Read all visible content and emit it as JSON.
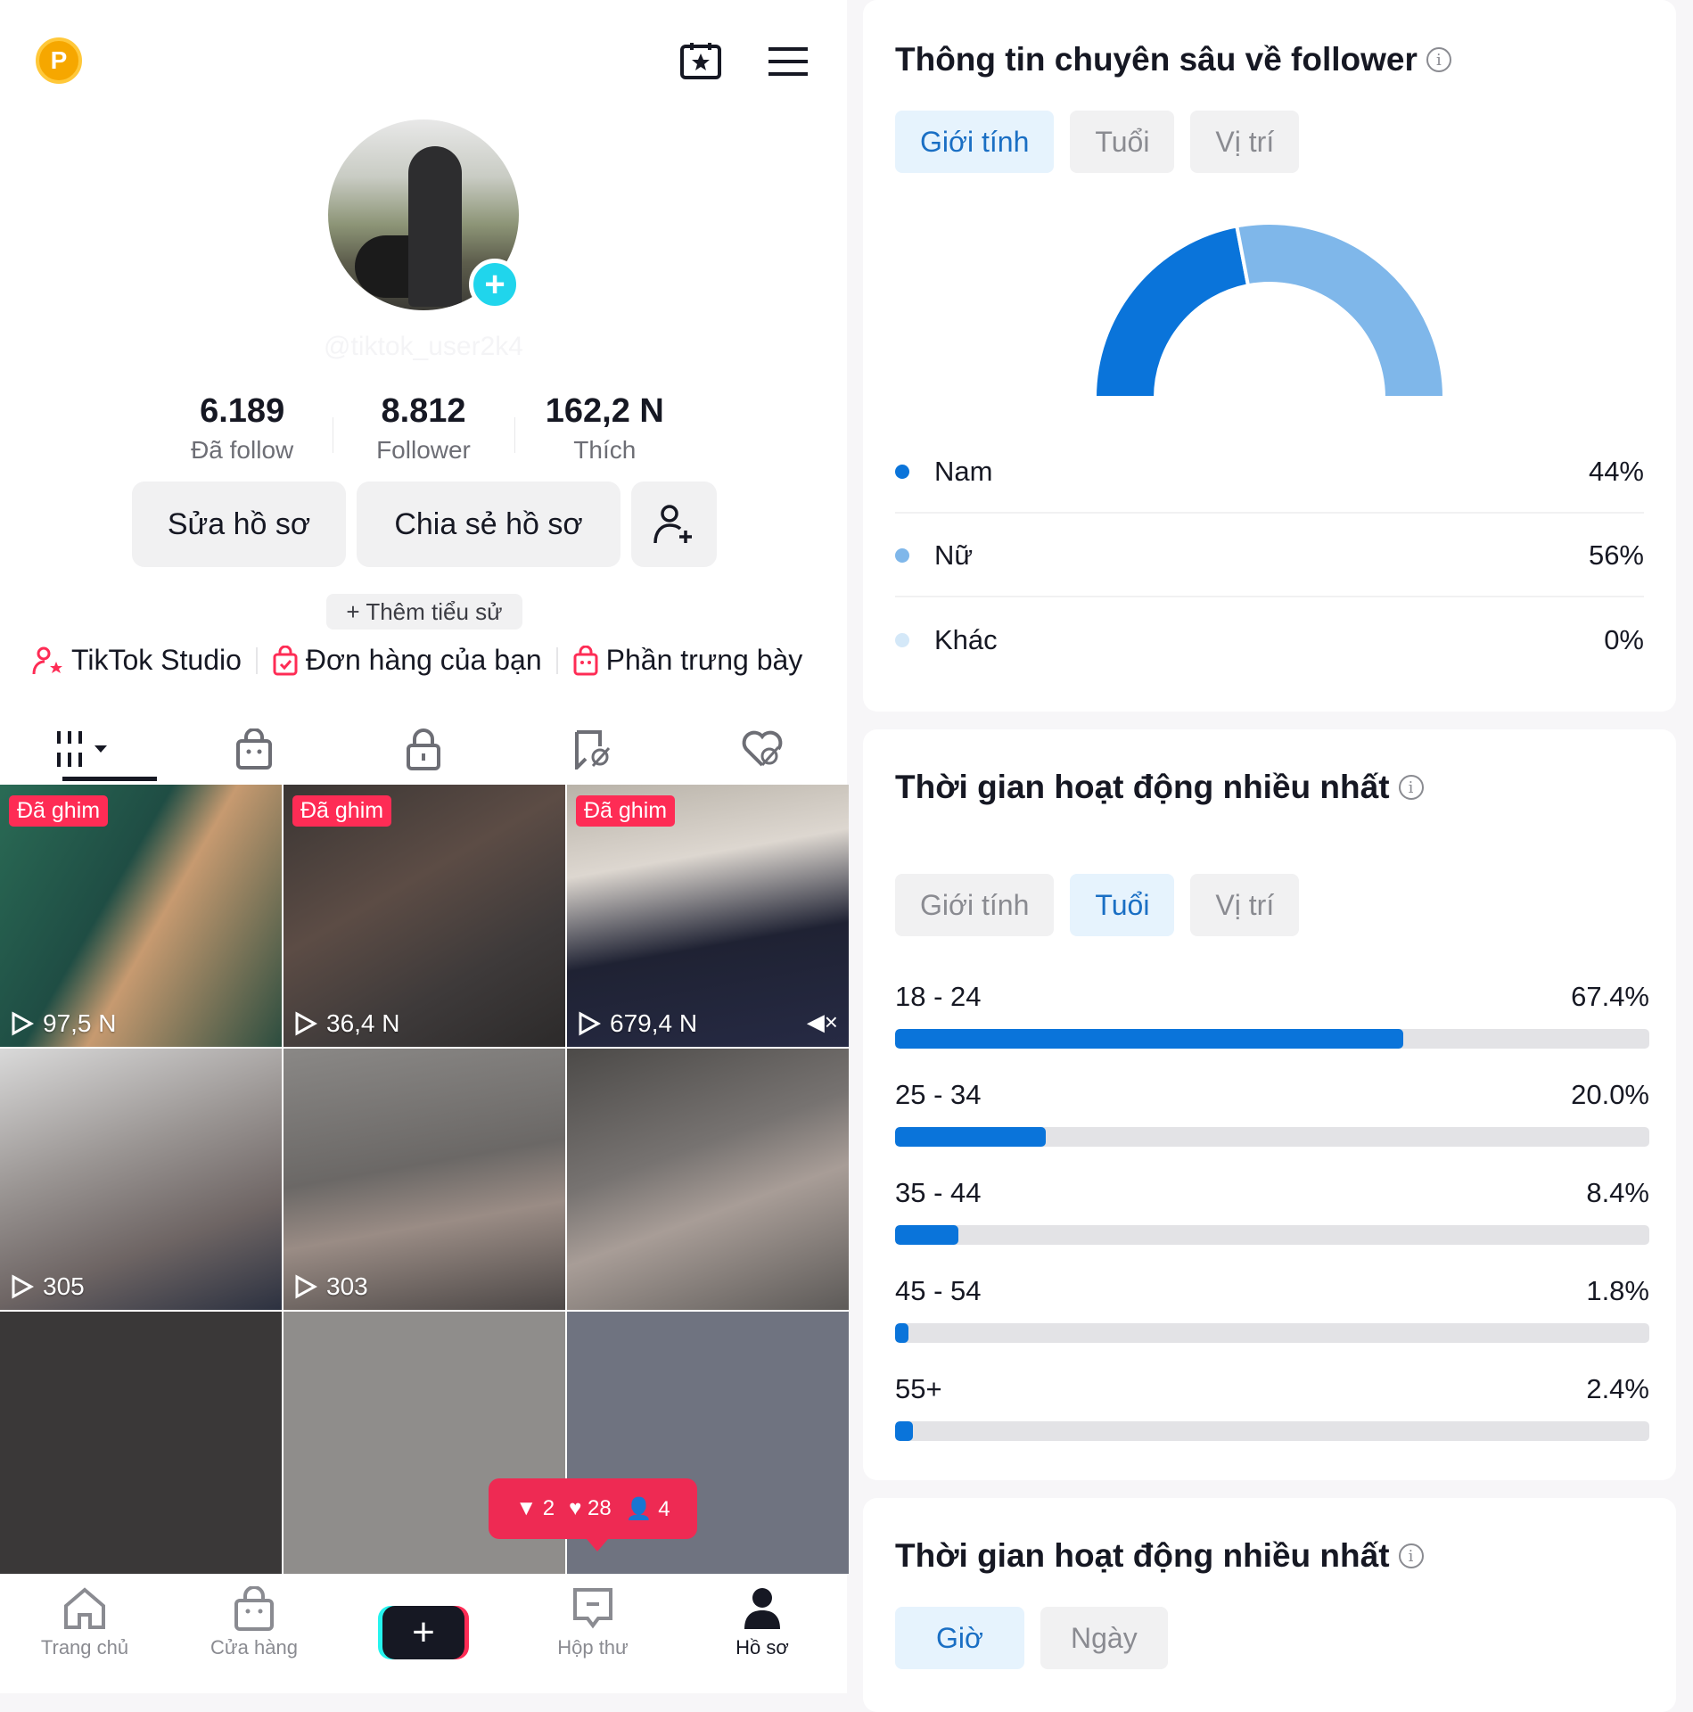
{
  "profile": {
    "handle": "@tiktok_user2k4",
    "stats": [
      {
        "value": "6.189",
        "label": "Đã follow"
      },
      {
        "value": "8.812",
        "label": "Follower"
      },
      {
        "value": "162,2 N",
        "label": "Thích"
      }
    ],
    "buttons": {
      "edit": "Sửa hồ sơ",
      "share": "Chia sẻ hồ sơ"
    },
    "add_bio": "+ Thêm tiểu sử",
    "links": [
      {
        "label": "TikTok Studio",
        "icon": "creator-star-icon"
      },
      {
        "label": "Đơn hàng của bạn",
        "icon": "order-bag-icon"
      },
      {
        "label": "Phần trưng bày",
        "icon": "showcase-bag-icon"
      }
    ]
  },
  "videos": [
    {
      "pinned": "Đã ghim",
      "views": "97,5 N"
    },
    {
      "pinned": "Đã ghim",
      "views": "36,4 N"
    },
    {
      "pinned": "Đã ghim",
      "views": "679,4 N",
      "muted": "🔇"
    },
    {
      "views": "305"
    },
    {
      "views": "303"
    },
    {
      "views": ""
    }
  ],
  "activity_popup": {
    "shares": "2",
    "likes": "28",
    "followers": "4"
  },
  "bottom_nav": [
    {
      "label": "Trang chủ"
    },
    {
      "label": "Cửa hàng"
    },
    {
      "label": "+"
    },
    {
      "label": "Hộp thư"
    },
    {
      "label": "Hồ sơ"
    }
  ],
  "insights": {
    "title": "Thông tin chuyên sâu về follower",
    "tabs": [
      "Giới tính",
      "Tuổi",
      "Vị trí"
    ],
    "gender": [
      {
        "label": "Nam",
        "pct": "44%",
        "value": 44,
        "color": "#0a74da"
      },
      {
        "label": "Nữ",
        "pct": "56%",
        "value": 56,
        "color": "#7fb7ea"
      },
      {
        "label": "Khác",
        "pct": "0%",
        "value": 0,
        "color": "#d4e8f8"
      }
    ]
  },
  "age_card": {
    "title": "Thời gian hoạt động nhiều nhất",
    "tabs": [
      "Giới tính",
      "Tuổi",
      "Vị trí"
    ],
    "ages": [
      {
        "label": "18 - 24",
        "pct": "67.4%",
        "value": 67.4
      },
      {
        "label": "25 - 34",
        "pct": "20.0%",
        "value": 20.0
      },
      {
        "label": "35 - 44",
        "pct": "8.4%",
        "value": 8.4
      },
      {
        "label": "45 - 54",
        "pct": "1.8%",
        "value": 1.8
      },
      {
        "label": "55+",
        "pct": "2.4%",
        "value": 2.4
      }
    ]
  },
  "time_card": {
    "title": "Thời gian hoạt động nhiều nhất",
    "tabs": [
      "Giờ",
      "Ngày"
    ]
  },
  "chart_data": [
    {
      "type": "pie",
      "title": "Thông tin chuyên sâu về follower",
      "categories": [
        "Nam",
        "Nữ",
        "Khác"
      ],
      "values": [
        44,
        56,
        0
      ]
    },
    {
      "type": "bar",
      "title": "Tuổi",
      "categories": [
        "18 - 24",
        "25 - 34",
        "35 - 44",
        "45 - 54",
        "55+"
      ],
      "values": [
        67.4,
        20.0,
        8.4,
        1.8,
        2.4
      ],
      "ylim": [
        0,
        100
      ]
    }
  ]
}
